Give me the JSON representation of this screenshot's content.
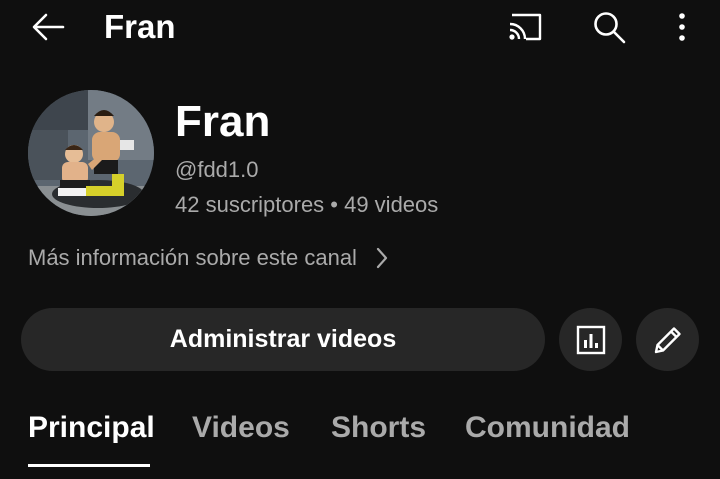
{
  "header": {
    "title": "Fran",
    "icons": [
      "back-arrow-icon",
      "cast-icon",
      "search-icon",
      "more-vertical-icon"
    ]
  },
  "channel": {
    "name": "Fran",
    "handle": "@fdd1.0",
    "stats": "42 suscriptores • 49 videos",
    "more_info": "Más información sobre este canal"
  },
  "actions": {
    "manage_label": "Administrar videos",
    "icons": [
      "analytics-icon",
      "edit-pencil-icon"
    ]
  },
  "tabs": [
    {
      "label": "Principal",
      "active": true
    },
    {
      "label": "Videos",
      "active": false
    },
    {
      "label": "Shorts",
      "active": false
    },
    {
      "label": "Comunidad",
      "active": false
    }
  ],
  "colors": {
    "background": "#0f0f0f",
    "button_bg": "#272727",
    "secondary_text": "#aaaaaa",
    "primary_text": "#ffffff"
  }
}
